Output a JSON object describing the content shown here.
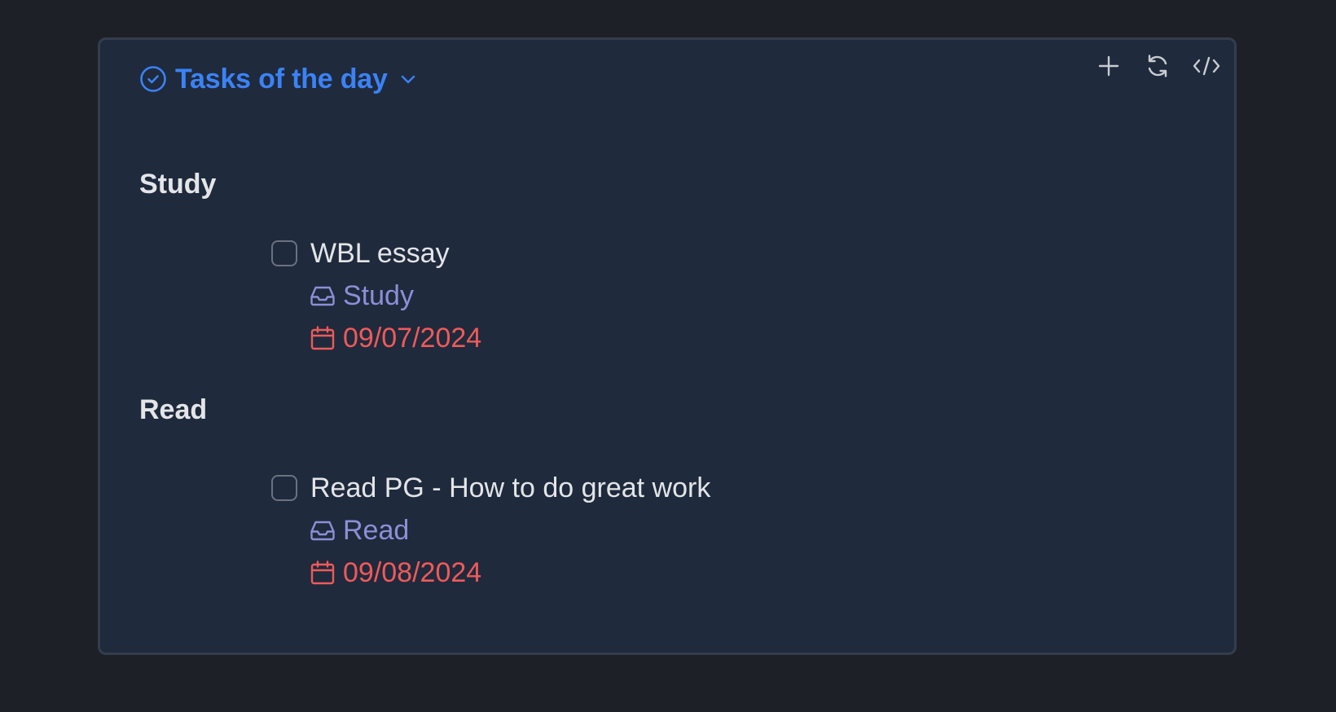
{
  "header": {
    "title": "Tasks of the day",
    "title_icon": "check-circle-icon",
    "dropdown_icon": "chevron-down-icon"
  },
  "toolbar": {
    "items": [
      {
        "name": "add-task-button",
        "icon": "plus-icon"
      },
      {
        "name": "refresh-button",
        "icon": "refresh-icon"
      },
      {
        "name": "code-view-button",
        "icon": "code-icon"
      }
    ]
  },
  "groups": [
    {
      "title": "Study",
      "tasks": [
        {
          "text": "WBL essay",
          "project": "Study",
          "due": "09/07/2024"
        }
      ]
    },
    {
      "title": "Read",
      "tasks": [
        {
          "text": "Read PG - How to do great work",
          "project": "Read",
          "due": "09/08/2024"
        }
      ]
    }
  ],
  "colors": {
    "accent": "#3b82f6",
    "project": "#8b90d6",
    "due": "#ef5a5a",
    "panel_bg": "#1f2a3c",
    "page_bg": "#1d2026"
  }
}
